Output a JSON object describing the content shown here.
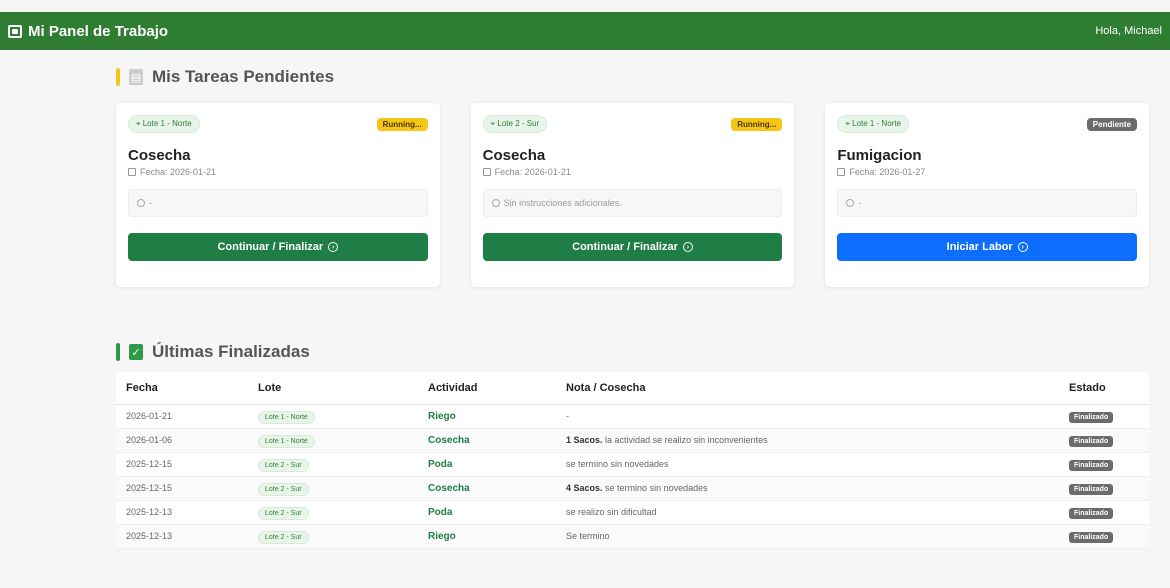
{
  "navbar": {
    "brand": "Mi Panel de Trabajo",
    "greeting": "Hola, Michael",
    "brand_icon": "id-card-icon"
  },
  "pending": {
    "title": "Mis Tareas Pendientes",
    "title_icon": "clipboard-icon",
    "accent": "#f5c518",
    "cards": [
      {
        "location": "Lote 1 - Norte",
        "status": "Running...",
        "title": "Cosecha",
        "date": "Fecha: 2026-01-21",
        "note": "-",
        "button": "Continuar / Finalizar"
      },
      {
        "location": "Lote 2 - Sur",
        "status": "Running...",
        "title": "Cosecha",
        "date": "Fecha: 2026-01-21",
        "note": "Sin instrucciones adicionales.",
        "button": "Continuar / Finalizar"
      },
      {
        "location": "Lote 1 - Norte",
        "status": "Pendiente",
        "title": "Fumigacion",
        "date": "Fecha: 2026-01-27",
        "note": "-",
        "button": "Iniciar Labor"
      }
    ]
  },
  "finished": {
    "title": "Últimas Finalizadas",
    "title_icon": "check-square-icon",
    "accent": "#2e9a46",
    "columns": [
      "Fecha",
      "Lote",
      "Actividad",
      "Nota / Cosecha",
      "Estado"
    ],
    "rows": [
      {
        "date": "2026-01-21",
        "lote": "Lote 1 - Norte",
        "activity": "Riego",
        "note_strong": "",
        "note": "-",
        "status": "Finalizado"
      },
      {
        "date": "2026-01-06",
        "lote": "Lote 1 - Norte",
        "activity": "Cosecha",
        "note_strong": "1 Sacos.",
        "note": "la actividad se realizo sin inconvenientes",
        "status": "Finalizado"
      },
      {
        "date": "2025-12-15",
        "lote": "Lote 2 - Sur",
        "activity": "Poda",
        "note_strong": "",
        "note": "se termino sin novedades",
        "status": "Finalizado"
      },
      {
        "date": "2025-12-15",
        "lote": "Lote 2 - Sur",
        "activity": "Cosecha",
        "note_strong": "4 Sacos.",
        "note": "se termino sin novedades",
        "status": "Finalizado"
      },
      {
        "date": "2025-12-13",
        "lote": "Lote 2 - Sur",
        "activity": "Poda",
        "note_strong": "",
        "note": "se realizo sin dificultad",
        "status": "Finalizado"
      },
      {
        "date": "2025-12-13",
        "lote": "Lote 2 - Sur",
        "activity": "Riego",
        "note_strong": "",
        "note": "Se termino",
        "status": "Finalizado"
      }
    ]
  },
  "colors": {
    "navbar": "#2f7d32",
    "button_green": "#1e7e45",
    "button_blue": "#0d6efd",
    "running": "#f5c518",
    "pending": "#6b6b6b"
  }
}
